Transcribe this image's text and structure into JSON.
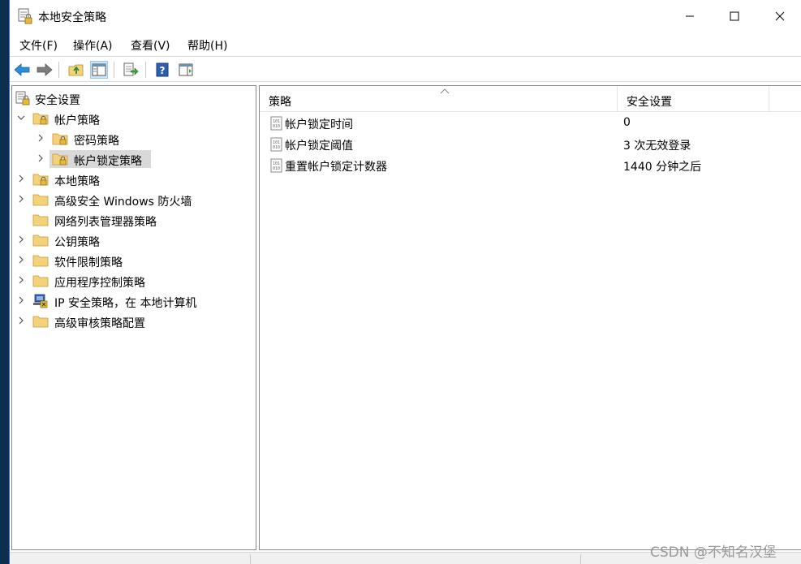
{
  "window": {
    "title": "本地安全策略"
  },
  "menu": [
    "文件(F)",
    "操作(A)",
    "查看(V)",
    "帮助(H)"
  ],
  "toolbar": {
    "buttons": [
      "back-icon",
      "forward-icon",
      "up-folder-icon",
      "show-hide-tree-icon",
      "export-list-icon",
      "help-icon",
      "properties-icon"
    ]
  },
  "tree": [
    {
      "label": "安全设置",
      "icon": "security-settings-icon"
    },
    {
      "label": "帐户策略",
      "icon": "locked-folder-icon",
      "expanded": true
    },
    {
      "label": "密码策略",
      "icon": "locked-folder-icon"
    },
    {
      "label": "帐户锁定策略",
      "icon": "locked-folder-icon",
      "selected": true
    },
    {
      "label": "本地策略",
      "icon": "locked-folder-icon"
    },
    {
      "label": "高级安全 Windows 防火墙",
      "icon": "folder-icon"
    },
    {
      "label": "网络列表管理器策略",
      "icon": "folder-icon"
    },
    {
      "label": "公钥策略",
      "icon": "folder-icon"
    },
    {
      "label": "软件限制策略",
      "icon": "folder-icon"
    },
    {
      "label": "应用程序控制策略",
      "icon": "folder-icon"
    },
    {
      "label": "IP 安全策略，在 本地计算机",
      "icon": "ip-security-icon"
    },
    {
      "label": "高级审核策略配置",
      "icon": "folder-icon"
    }
  ],
  "list": {
    "columns": [
      "策略",
      "安全设置"
    ],
    "rows": [
      {
        "name": "帐户锁定时间",
        "value": "0"
      },
      {
        "name": "帐户锁定阈值",
        "value": "3 次无效登录"
      },
      {
        "name": "重置帐户锁定计数器",
        "value": "1440 分钟之后"
      }
    ]
  },
  "watermark": "CSDN @不知名汉堡",
  "colors": {
    "accent_blue": "#1e88e5",
    "folder_yellow": "#f4d27a",
    "selection": "#d9d9d9"
  }
}
